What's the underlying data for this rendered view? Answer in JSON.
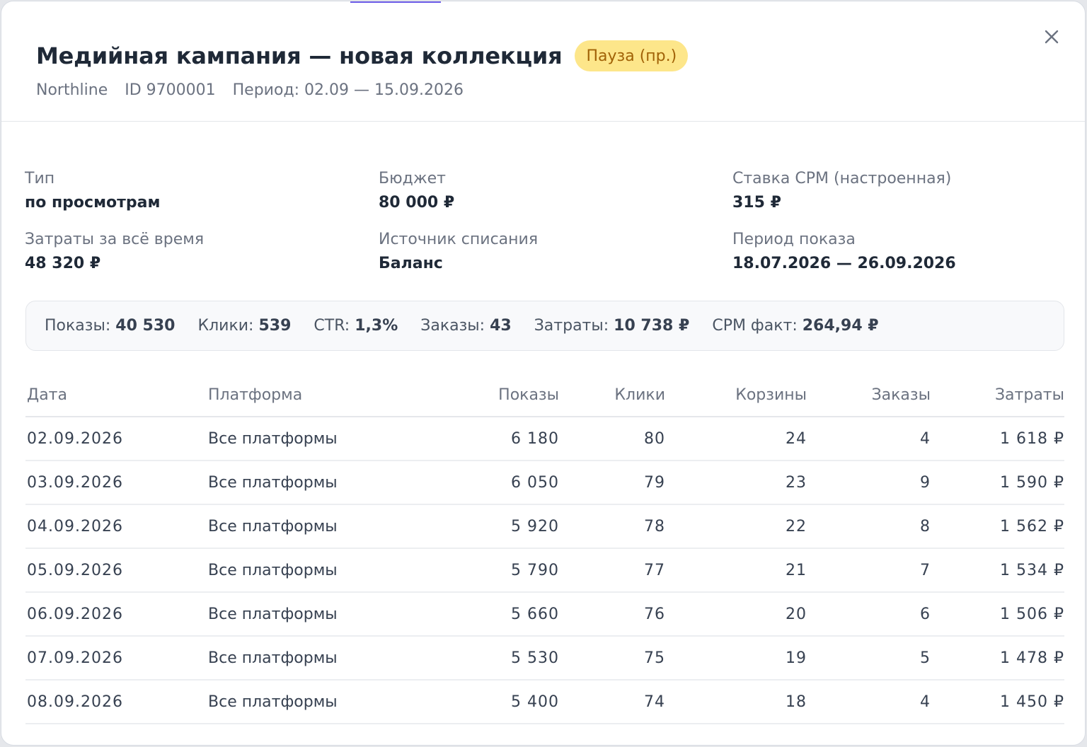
{
  "header": {
    "title": "Медийная кампания — новая коллекция",
    "status_badge": "Пауза (пр.)",
    "brand": "Northline",
    "id_text": "ID 9700001",
    "period_text": "Период: 02.09 — 15.09.2026",
    "close_icon": "close-icon"
  },
  "info": {
    "type_label": "Тип",
    "type_value": "по просмотрам",
    "budget_label": "Бюджет",
    "budget_value": "80 000 ₽",
    "cpm_label": "Ставка CPM (настроенная)",
    "cpm_value": "315 ₽",
    "spent_label": "Затраты за всё время",
    "spent_value": "48 320 ₽",
    "source_label": "Источник списания",
    "source_value": "Баланс",
    "show_period_label": "Период показа",
    "show_period_value": "18.07.2026 — 26.09.2026"
  },
  "summary": {
    "impressions_label": "Показы:",
    "impressions_value": "40 530",
    "clicks_label": "Клики:",
    "clicks_value": "539",
    "ctr_label": "CTR:",
    "ctr_value": "1,3%",
    "orders_label": "Заказы:",
    "orders_value": "43",
    "cost_label": "Затраты:",
    "cost_value": "10 738 ₽",
    "cpm_fact_label": "CPM факт:",
    "cpm_fact_value": "264,94 ₽"
  },
  "table": {
    "headers": [
      "Дата",
      "Платформа",
      "Показы",
      "Клики",
      "Корзины",
      "Заказы",
      "Затраты"
    ],
    "rows": [
      [
        "02.09.2026",
        "Все платформы",
        "6 180",
        "80",
        "24",
        "4",
        "1 618 ₽"
      ],
      [
        "03.09.2026",
        "Все платформы",
        "6 050",
        "79",
        "23",
        "9",
        "1 590 ₽"
      ],
      [
        "04.09.2026",
        "Все платформы",
        "5 920",
        "78",
        "22",
        "8",
        "1 562 ₽"
      ],
      [
        "05.09.2026",
        "Все платформы",
        "5 790",
        "77",
        "21",
        "7",
        "1 534 ₽"
      ],
      [
        "06.09.2026",
        "Все платформы",
        "5 660",
        "76",
        "20",
        "6",
        "1 506 ₽"
      ],
      [
        "07.09.2026",
        "Все платформы",
        "5 530",
        "75",
        "19",
        "5",
        "1 478 ₽"
      ],
      [
        "08.09.2026",
        "Все платформы",
        "5 400",
        "74",
        "18",
        "4",
        "1 450 ₽"
      ]
    ]
  },
  "colors": {
    "badge_bg": "#fde68a",
    "badge_text": "#a16207",
    "accent": "#6d5ce8"
  }
}
